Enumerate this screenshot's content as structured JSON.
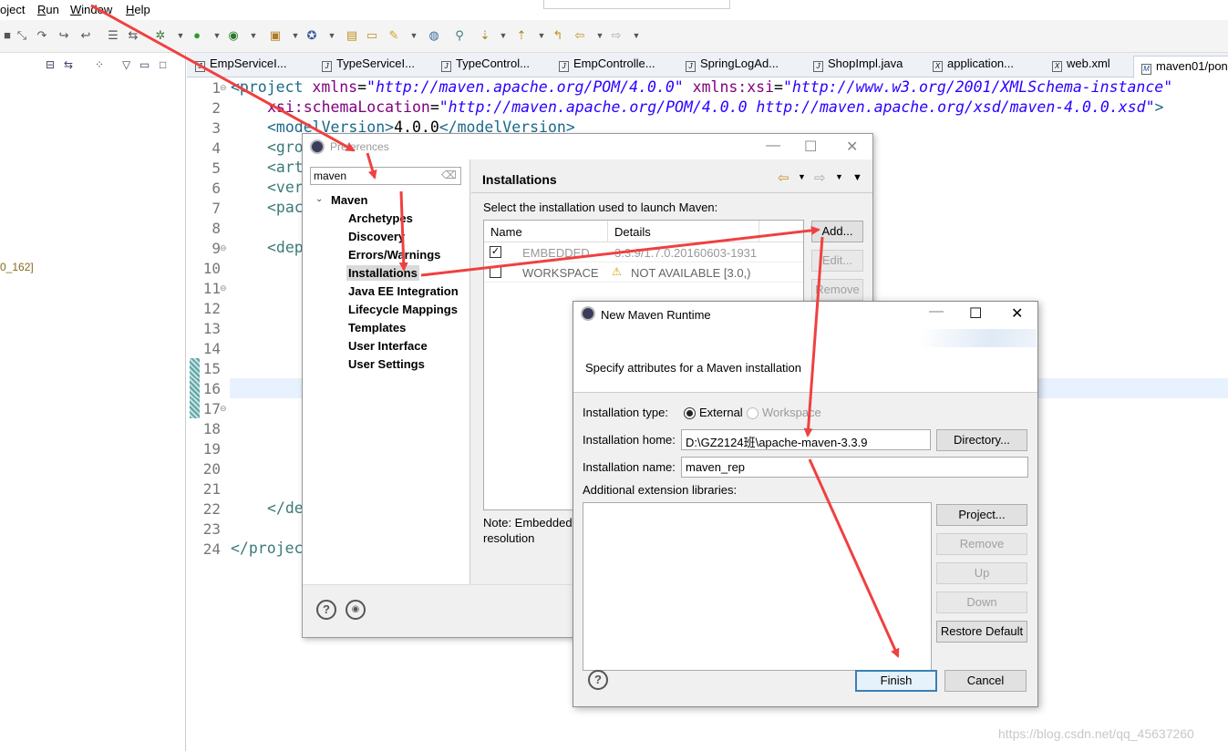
{
  "menubar": {
    "items": [
      {
        "label": "oject",
        "underline": "",
        "rest": "oject"
      },
      {
        "label": "Run",
        "underline": "R",
        "rest": "un"
      },
      {
        "label": "Window",
        "underline": "W",
        "rest": "indow"
      },
      {
        "label": "Help",
        "underline": "H",
        "rest": "elp"
      }
    ]
  },
  "left_panel": {
    "jdk_label": "0_162]"
  },
  "tabs": [
    {
      "label": "EmpServiceI...",
      "icon": "J"
    },
    {
      "label": "TypeServiceI...",
      "icon": "J"
    },
    {
      "label": "TypeControl...",
      "icon": "J"
    },
    {
      "label": "EmpControlle...",
      "icon": "J"
    },
    {
      "label": "SpringLogAd...",
      "icon": "J"
    },
    {
      "label": "ShopImpl.java",
      "icon": "J"
    },
    {
      "label": "application...",
      "icon": "X"
    },
    {
      "label": "web.xml",
      "icon": "X"
    },
    {
      "label": "maven01/pon",
      "icon": "M"
    }
  ],
  "editor": {
    "line_numbers": [
      "1",
      "2",
      "3",
      "4",
      "5",
      "6",
      "7",
      "8",
      "9",
      "10",
      "11",
      "12",
      "13",
      "14",
      "15",
      "16",
      "17",
      "18",
      "19",
      "20",
      "21",
      "22",
      "23",
      "24"
    ],
    "line1": {
      "open": "<project ",
      "a1": "xmlns",
      "eq": "=",
      "v1": "\"http://maven.apache.org/POM/4.0.0\"",
      "a2": " xmlns:xsi",
      "v2": "\"http://www.w3.org/2001/XMLSchema-instance\""
    },
    "line2": {
      "a": "xsi:schemaLocation",
      "v": "\"http://maven.apache.org/POM/4.0.0 http://maven.apache.org/xsd/maven-4.0.0.xsd\"",
      "close": ">"
    },
    "line3": {
      "open": "<modelVersion>",
      "text": "4.0.0",
      "close": "</modelVersion>"
    },
    "line4": "<gro",
    "line5": "<art",
    "line6": "<ver",
    "line7": "<pac",
    "line9": "<dep",
    "line22": "</de",
    "line24": "</projec"
  },
  "preferences": {
    "title": "Preferences",
    "search_value": "maven",
    "tree_root": "Maven",
    "tree_items": [
      "Archetypes",
      "Discovery",
      "Errors/Warnings",
      "Installations",
      "Java EE Integration",
      "Lifecycle Mappings",
      "Templates",
      "User Interface",
      "User Settings"
    ],
    "selected_item": "Installations",
    "page_title": "Installations",
    "instruction": "Select the installation used to launch Maven:",
    "table_headers": [
      "Name",
      "Details"
    ],
    "table_rows": [
      {
        "checked": true,
        "name": "EMBEDDED",
        "details": "3.3.9/1.7.0.20160603-1931"
      },
      {
        "checked": false,
        "name": "WORKSPACE",
        "details": "NOT AVAILABLE [3.0,)"
      }
    ],
    "buttons": {
      "add": "Add...",
      "edit": "Edit...",
      "remove": "Remove"
    },
    "note_line1": "Note: Embedded",
    "note_line2": "resolution"
  },
  "new_runtime": {
    "title": "New Maven Runtime",
    "description": "Specify attributes for a Maven installation",
    "type_label": "Installation type:",
    "type_external": "External",
    "type_workspace": "Workspace",
    "home_label": "Installation home:",
    "home_value": "D:\\GZ2124班\\apache-maven-3.3.9",
    "directory_button": "Directory...",
    "name_label": "Installation name:",
    "name_value": "maven_rep",
    "libraries_label": "Additional extension libraries:",
    "buttons": {
      "project": "Project...",
      "remove": "Remove",
      "up": "Up",
      "down": "Down",
      "restore": "Restore Default",
      "finish": "Finish",
      "cancel": "Cancel"
    }
  },
  "watermark": "https://blog.csdn.net/qq_45637260",
  "colors": {
    "annotation_arrow": "#f04040",
    "accent": "#3c7fb1"
  }
}
